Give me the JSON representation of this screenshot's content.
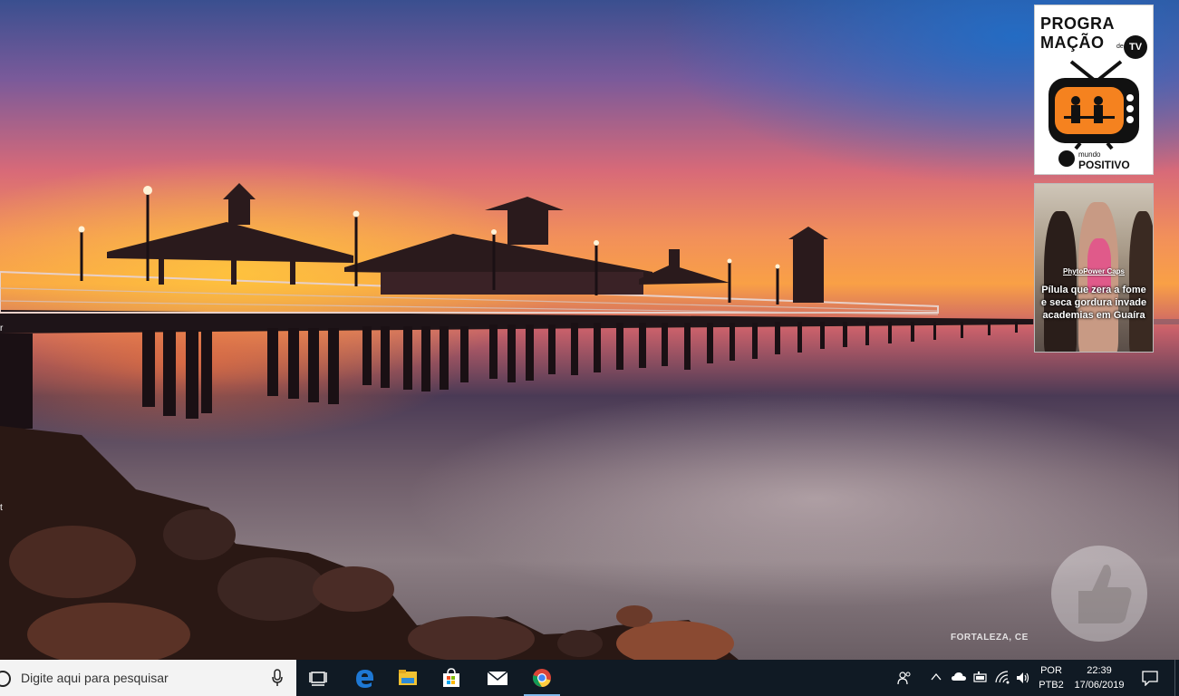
{
  "desktop": {
    "caption": "FORTALEZA, CE",
    "edge_labels": [
      "r",
      "t"
    ]
  },
  "widgets": {
    "tv": {
      "title_line1": "PROGRA",
      "title_line2": "MAÇÃO",
      "badge_de": "de",
      "badge_tv": "TV",
      "brand_small": "mundo",
      "brand": "POSITIVO"
    },
    "ad": {
      "brand": "PhytoPower Caps",
      "text": "Pílula que zera a fome e seca gordura invade academias em Guaíra"
    }
  },
  "taskbar": {
    "search_placeholder": "Digite aqui para pesquisar",
    "pinned": [
      "task-view",
      "edge",
      "file-explorer",
      "store",
      "mail",
      "chrome"
    ],
    "active_app": "chrome",
    "tray": {
      "lang_line1": "POR",
      "lang_line2": "PTB2",
      "time": "22:39",
      "date": "17/06/2019"
    }
  },
  "colors": {
    "taskbar_bg": "#101a24",
    "active_indicator": "#7fb7ea"
  }
}
